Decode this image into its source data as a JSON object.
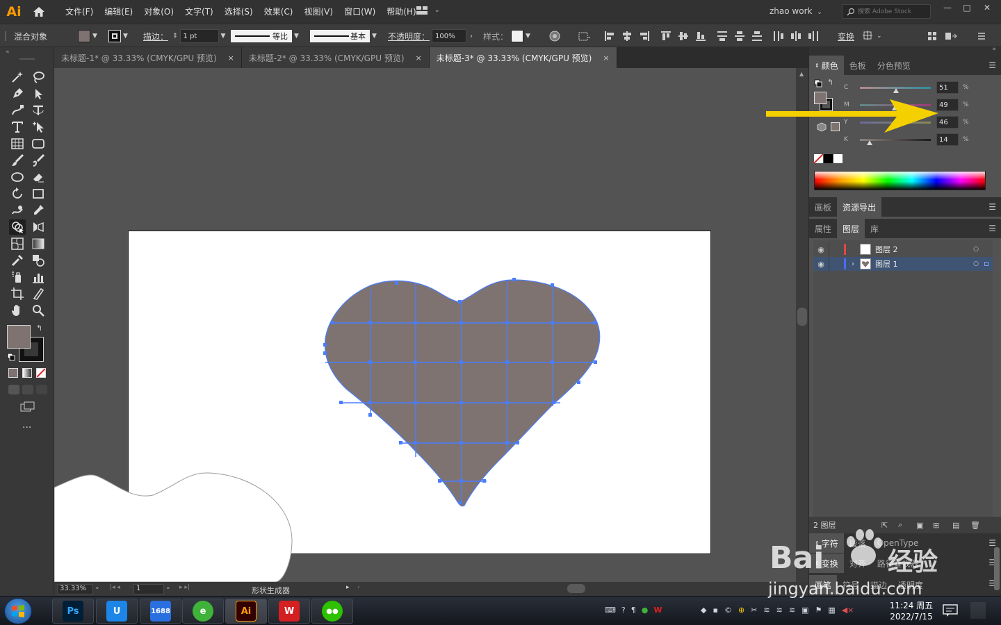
{
  "app": {
    "logo_text": "Ai"
  },
  "menu": [
    "文件(F)",
    "编辑(E)",
    "对象(O)",
    "文字(T)",
    "选择(S)",
    "效果(C)",
    "视图(V)",
    "窗口(W)",
    "帮助(H)"
  ],
  "header": {
    "workspace": "zhao work",
    "search_placeholder": "搜索 Adobe Stock"
  },
  "controlbar": {
    "object_type": "混合对象",
    "stroke_label": "描边：",
    "stroke_weight": "1 pt",
    "profile_label": "等比",
    "brush_label": "基本",
    "opacity_label": "不透明度：",
    "opacity_value": "100%",
    "style_label": "样式：",
    "transform_label": "变换"
  },
  "colors": {
    "fill": "#7e7370",
    "accent_blue": "#4a7dff",
    "arrow": "#f5d000"
  },
  "tabs": [
    {
      "label": "未标题-1* @ 33.33% (CMYK/GPU 预览)",
      "close": "×"
    },
    {
      "label": "未标题-2* @ 33.33% (CMYK/GPU 预览)",
      "close": "×"
    },
    {
      "label": "未标题-3* @ 33.33% (CMYK/GPU 预览)",
      "close": "×"
    }
  ],
  "statusbar": {
    "zoom": "33.33%",
    "page": "1",
    "tool_name": "形状生成器"
  },
  "color_panel": {
    "tabs": [
      "颜色",
      "色板",
      "分色预览"
    ],
    "channels": [
      {
        "label": "C",
        "value": "51",
        "fraction": 0.51,
        "unit": "%"
      },
      {
        "label": "M",
        "value": "49",
        "fraction": 0.49,
        "unit": "%"
      },
      {
        "label": "Y",
        "value": "46",
        "fraction": 0.46,
        "unit": "%"
      },
      {
        "label": "K",
        "value": "14",
        "fraction": 0.14,
        "unit": "%"
      }
    ]
  },
  "asset_panel": {
    "tabs": [
      "画板",
      "资源导出"
    ]
  },
  "layers_panel": {
    "tabs": [
      "属性",
      "图层",
      "库"
    ],
    "layers": [
      {
        "name": "图层 2",
        "color": "#e64545"
      },
      {
        "name": "图层 1",
        "color": "#4a6cff"
      }
    ],
    "footer_count": "2 图层"
  },
  "bottom_panels": {
    "row1": [
      "字符",
      "段落",
      "OpenType"
    ],
    "row2": [
      "变换",
      "对齐",
      "路径查找器"
    ],
    "row3": [
      "画笔",
      "符号",
      "描边",
      "透明度"
    ]
  },
  "taskbar": {
    "apps": [
      {
        "name": "photoshop",
        "text": "Ps",
        "color": "#001e36",
        "fg": "#31a8ff"
      },
      {
        "name": "u-app",
        "text": "U",
        "color": "#1c86e8",
        "fg": "#ffffff"
      },
      {
        "name": "1688",
        "text": "1688",
        "color": "#2a6fe0",
        "fg": "#ffffff"
      },
      {
        "name": "browser",
        "text": "e",
        "color": "#3fb23a",
        "fg": "#ffffff"
      },
      {
        "name": "illustrator",
        "text": "Ai",
        "color": "#330000",
        "fg": "#ff9a00"
      },
      {
        "name": "wps",
        "text": "W",
        "color": "#d42020",
        "fg": "#ffffff"
      },
      {
        "name": "wechat",
        "text": "●●",
        "color": "#2dc100",
        "fg": "#ffffff"
      }
    ],
    "time": "11:24 周五",
    "date": "2022/7/15"
  },
  "watermark": {
    "brand": "Bai",
    "brand2": "经验",
    "url": "jingyan.baidu.com"
  }
}
